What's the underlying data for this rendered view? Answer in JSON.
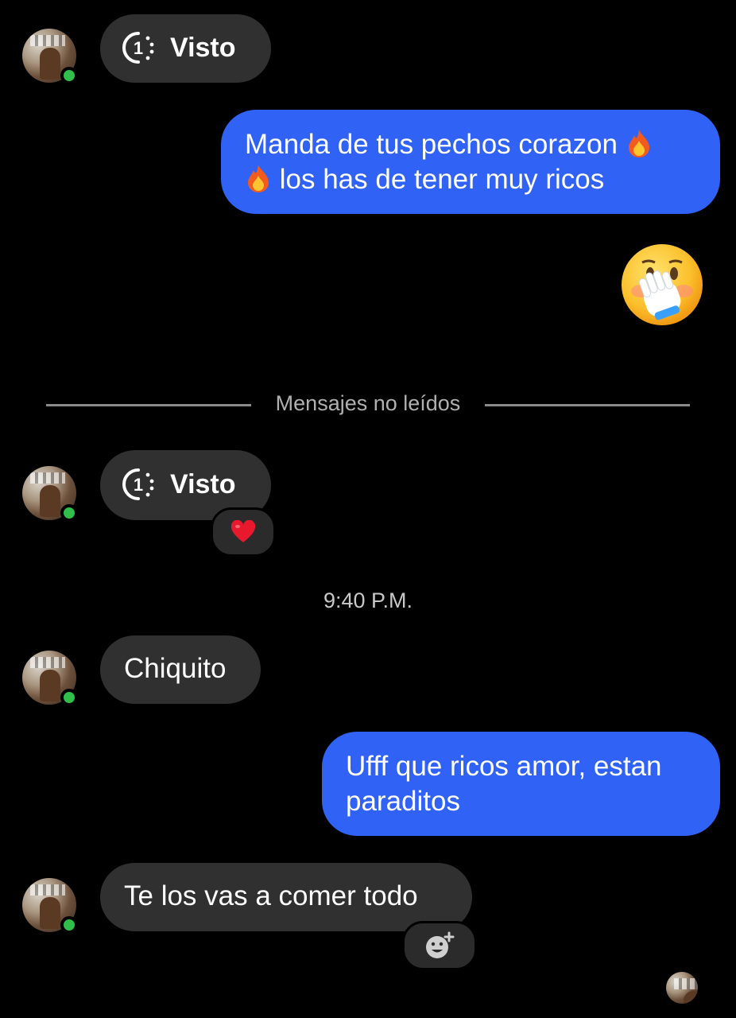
{
  "messages": {
    "visto_1": "Visto",
    "sent_1_line1": "Manda de tus pechos corazon",
    "sent_1_line2": "los has de tener muy ricos",
    "unread_divider": "Mensajes no leídos",
    "visto_2": "Visto",
    "timestamp": "9:40 P.M.",
    "received_chiquito": "Chiquito",
    "sent_2_line1": "Ufff que ricos amor, estan",
    "sent_2_line2": "paraditos",
    "received_last": "Te los vas a comer todo"
  },
  "reactions": {
    "visto_2_reaction": "heart"
  },
  "icons": {
    "view_once": "view-once-1-icon",
    "flame": "fire-emoji",
    "sticker": "hand-over-mouth-emoji",
    "add_reaction": "add-reaction-icon"
  },
  "colors": {
    "background": "#000000",
    "incoming_bubble": "#303030",
    "outgoing_bubble": "#2f62f5",
    "online_dot": "#2fbf4a",
    "divider": "#8a8a8a"
  }
}
